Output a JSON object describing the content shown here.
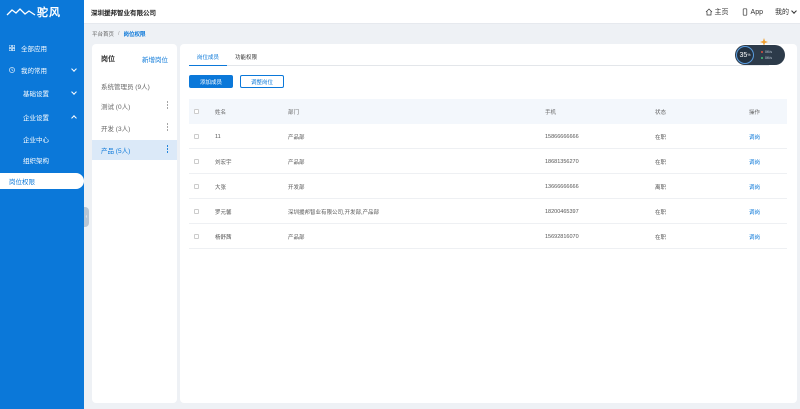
{
  "app": {
    "logo_text": "驼风"
  },
  "header": {
    "company": "深圳援邦智业有限公司",
    "home": "主页",
    "app_link": "App",
    "mine": "我的"
  },
  "sidebar": {
    "items": [
      {
        "label": "全部应用",
        "icon": "grid-icon"
      },
      {
        "label": "我的常用",
        "icon": "clock-icon"
      },
      {
        "label": "基础设置"
      },
      {
        "label": "企业设置"
      },
      {
        "label": "企业中心"
      },
      {
        "label": "组织架构"
      },
      {
        "label": "岗位权限"
      }
    ]
  },
  "breadcrumb": {
    "root": "平台首页",
    "sep": "/",
    "current": "岗位权限"
  },
  "positions": {
    "title": "岗位",
    "add": "新增岗位",
    "items": [
      {
        "label": "系统管理员 (9人)"
      },
      {
        "label": "测试 (0人)"
      },
      {
        "label": "开发 (3人)"
      },
      {
        "label": "产品 (5人)"
      }
    ]
  },
  "tabs": [
    {
      "label": "岗位成员"
    },
    {
      "label": "功能权限"
    }
  ],
  "buttons": {
    "add_member": "添加成员",
    "adjust_position": "调整岗位"
  },
  "table": {
    "headers": {
      "name": "姓名",
      "dept": "部门",
      "phone": "手机",
      "status": "状态",
      "op": "操作"
    },
    "rows": [
      {
        "name": "11",
        "dept": "产品部",
        "phone": "15866666666",
        "status": "在职",
        "op": "调岗"
      },
      {
        "name": "刘宏宇",
        "dept": "产品部",
        "phone": "18681356270",
        "status": "在职",
        "op": "调岗"
      },
      {
        "name": "大张",
        "dept": "开发部",
        "phone": "13666666666",
        "status": "离职",
        "op": "调岗"
      },
      {
        "name": "罗元馨",
        "dept": "深圳援邦智业有限公司,开发部,产品部",
        "phone": "18200465397",
        "status": "在职",
        "op": "调岗"
      },
      {
        "name": "杨舒茜",
        "dept": "产品部",
        "phone": "15692816070",
        "status": "在职",
        "op": "调岗"
      }
    ]
  },
  "speed_widget": {
    "percent": "35",
    "percent_unit": "%",
    "up": "0K/s",
    "down": "0K/s",
    "up_color": "#e0513f",
    "down_color": "#45c27a"
  },
  "colors": {
    "brand": "#0b78d9"
  }
}
